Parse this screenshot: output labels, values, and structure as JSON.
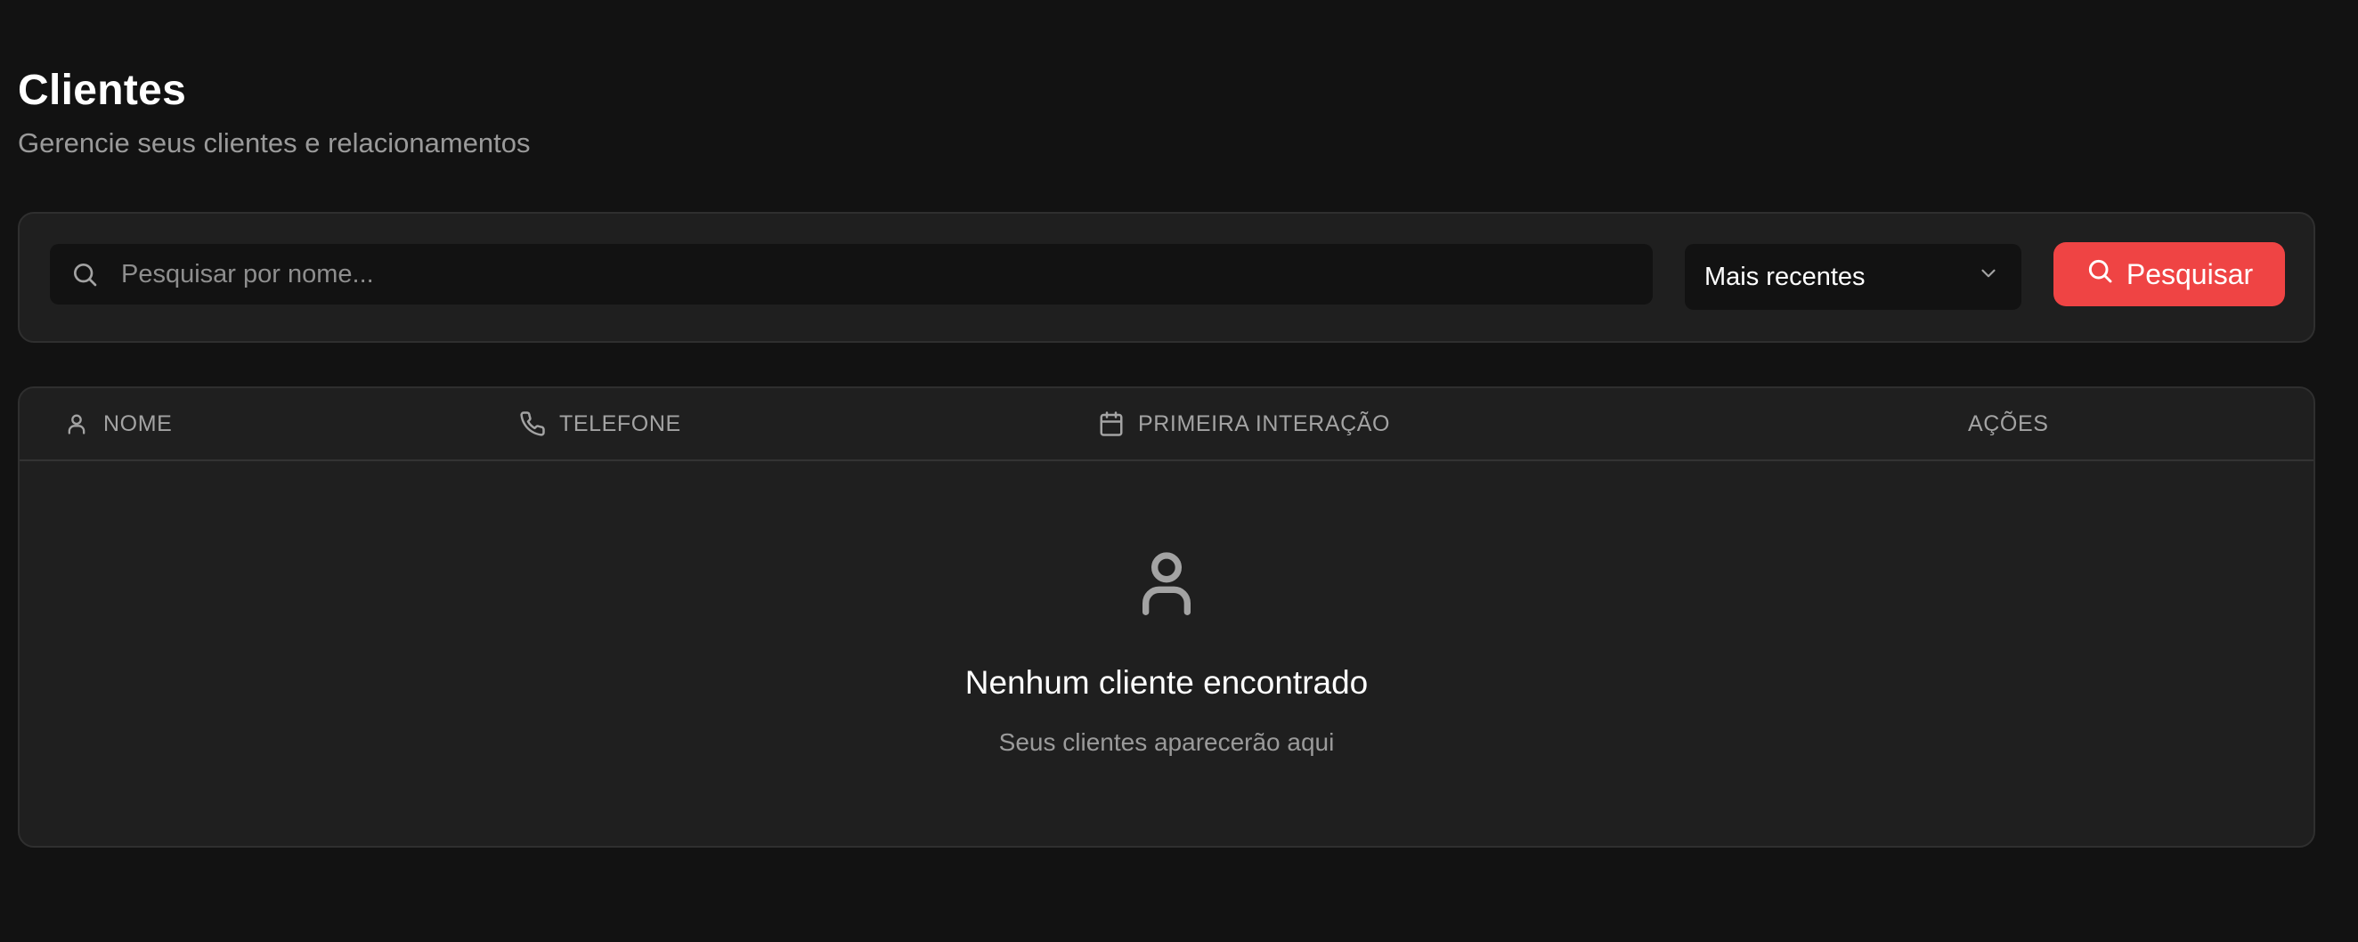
{
  "header": {
    "title": "Clientes",
    "subtitle": "Gerencie seus clientes e relacionamentos"
  },
  "filters": {
    "search": {
      "placeholder": "Pesquisar por nome...",
      "value": "",
      "icon": "search-icon"
    },
    "sort": {
      "selected": "Mais recentes",
      "icon": "chevron-down-icon"
    },
    "search_button": {
      "label": "Pesquisar",
      "icon": "search-icon"
    }
  },
  "table": {
    "columns": [
      {
        "label": "NOME",
        "icon": "user-icon"
      },
      {
        "label": "TELEFONE",
        "icon": "phone-icon"
      },
      {
        "label": "PRIMEIRA INTERAÇÃO",
        "icon": "calendar-icon"
      },
      {
        "label": "AÇÕES"
      }
    ],
    "rows": [],
    "empty_state": {
      "icon": "user-icon",
      "title": "Nenhum cliente encontrado",
      "subtitle": "Seus clientes aparecerão aqui"
    }
  },
  "colors": {
    "background": "#121212",
    "card": "#1f1f1f",
    "accent": "#ef4444",
    "muted_text": "#9a9a9a"
  }
}
